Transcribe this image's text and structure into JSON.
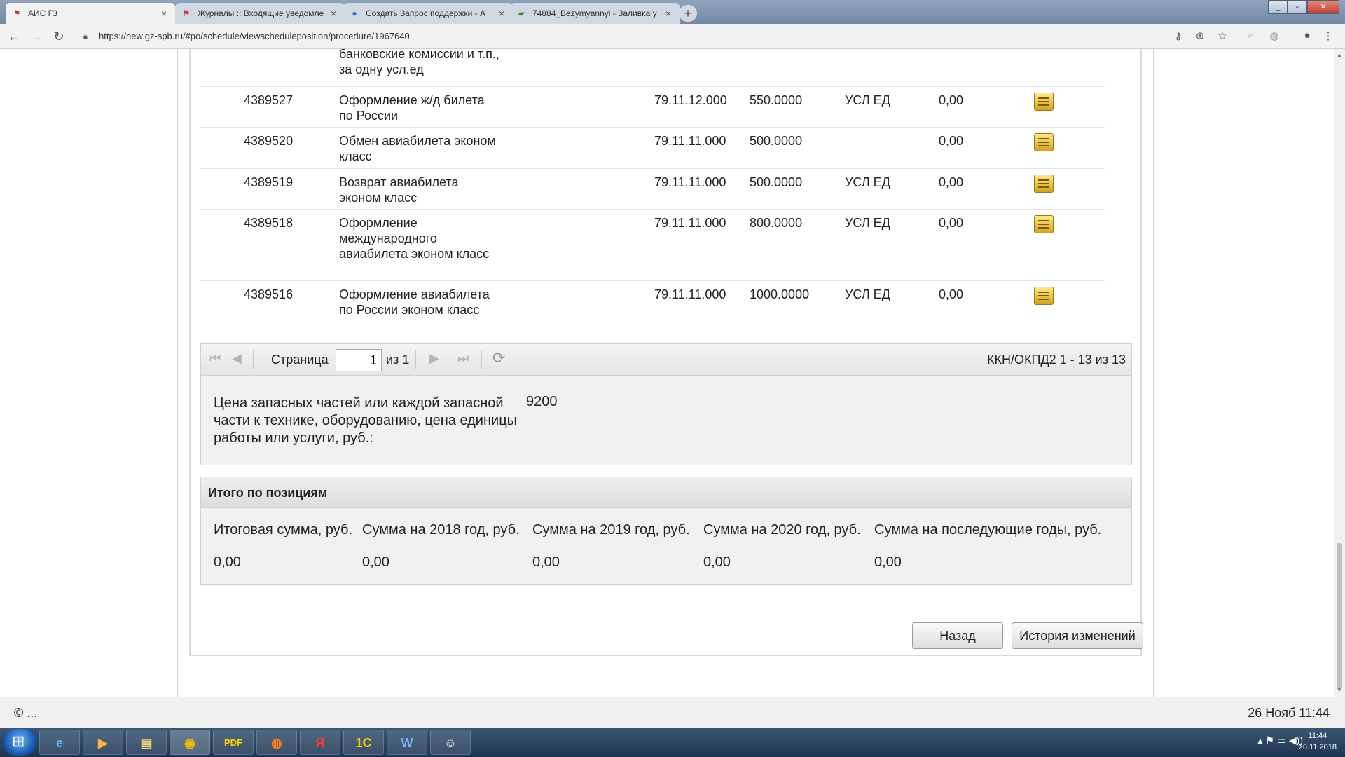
{
  "browser": {
    "tabs": [
      {
        "title": "АИС ГЗ",
        "icon": "ais-icon",
        "close": "×"
      },
      {
        "title": "Журналы :: Входящие уведомле",
        "icon": "ais-icon",
        "close": "×"
      },
      {
        "title": "Создать Запрос поддержки - А",
        "icon": "globe-icon",
        "close": "×"
      },
      {
        "title": "74884_Bezymyannyi - Заливка у",
        "icon": "flag-icon",
        "close": "×"
      }
    ],
    "new_tab": "+",
    "url": "https://new.gz-spb.ru/#po/schedule/viewscheduleposition/procedure/1967640"
  },
  "grid": {
    "partial_row_name": "банковские комиссии и т.п., за одну усл.ед",
    "rows": [
      {
        "id": "4389527",
        "name": "Оформление ж/д билета по России",
        "code": "79.11.12.000",
        "price": "550.0000",
        "unit": "УСЛ ЕД",
        "sum": "0,00"
      },
      {
        "id": "4389520",
        "name": "Обмен авиабилета эконом класс",
        "code": "79.11.11.000",
        "price": "500.0000",
        "unit": "",
        "sum": "0,00"
      },
      {
        "id": "4389519",
        "name": "Возврат авиабилета эконом класс",
        "code": "79.11.11.000",
        "price": "500.0000",
        "unit": "УСЛ ЕД",
        "sum": "0,00"
      },
      {
        "id": "4389518",
        "name": "Оформление международного авиабилета эконом класс",
        "code": "79.11.11.000",
        "price": "800.0000",
        "unit": "УСЛ ЕД",
        "sum": "0,00"
      },
      {
        "id": "4389516",
        "name": "Оформление авиабилета по России эконом класс",
        "code": "79.11.11.000",
        "price": "1000.0000",
        "unit": "УСЛ ЕД",
        "sum": "0,00"
      }
    ]
  },
  "pager": {
    "page_label": "Страница",
    "page_value": "1",
    "of_label": "из 1",
    "info": "ККН/ОКПД2 1 - 13 из 13"
  },
  "price_box": {
    "label": "Цена запасных частей или каждой запасной части к технике, оборудованию, цена единицы работы или услуги, руб.:",
    "value": "9200"
  },
  "totals": {
    "title": "Итого по позициям",
    "headers": [
      "Итоговая сумма, руб.",
      "Сумма на 2018 год, руб.",
      "Сумма на 2019 год, руб.",
      "Сумма на 2020 год, руб.",
      "Сумма на последующие годы, руб."
    ],
    "values": [
      "0,00",
      "0,00",
      "0,00",
      "0,00",
      "0,00"
    ]
  },
  "buttons": {
    "back": "Назад",
    "history": "История изменений"
  },
  "status": {
    "left": "© ...",
    "right": "26 Нояб 11:44"
  },
  "taskbar": {
    "apps": [
      "e",
      "▶",
      "▤",
      "◉",
      "PDF",
      "◍",
      "Я",
      "1С",
      "W",
      "☺"
    ],
    "time": "11:44",
    "date": "26.11.2018"
  }
}
